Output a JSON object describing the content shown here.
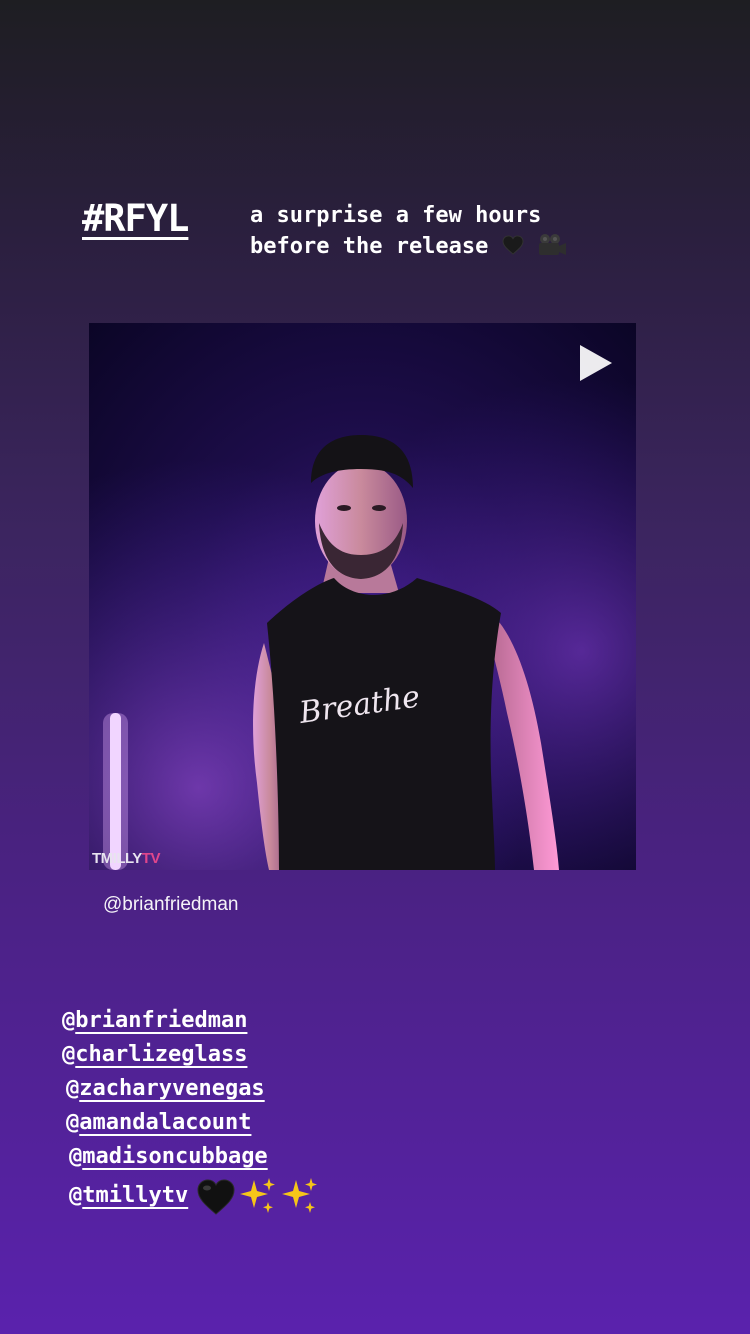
{
  "story": {
    "hashtag": "#RFYL",
    "caption_line1": "a surprise a few hours",
    "caption_line2": "before the release",
    "caption_emojis": [
      "black-heart-icon",
      "movie-camera-icon"
    ]
  },
  "shared_post": {
    "watermark_main": "TMILLY",
    "watermark_accent": "TV",
    "shirt_text": "Breathe",
    "author": "@brianfriedman",
    "play_icon": "play-icon"
  },
  "mentions": [
    {
      "at": "@",
      "handle": "brianfriedman"
    },
    {
      "at": "@",
      "handle": "charlizeglass"
    },
    {
      "at": "@",
      "handle": "zacharyvenegas"
    },
    {
      "at": "@",
      "handle": "amandalacount"
    },
    {
      "at": "@",
      "handle": "madisoncubbage"
    },
    {
      "at": "@",
      "handle": "tmillytv"
    }
  ],
  "trailing_emojis": [
    "black-heart-icon",
    "sparkles-icon",
    "sparkles-icon"
  ],
  "colors": {
    "bg_top": "#1e1e22",
    "bg_bottom": "#5a22ad",
    "watermark_accent": "#e0468c",
    "neon_light": "#f3d6ff"
  }
}
